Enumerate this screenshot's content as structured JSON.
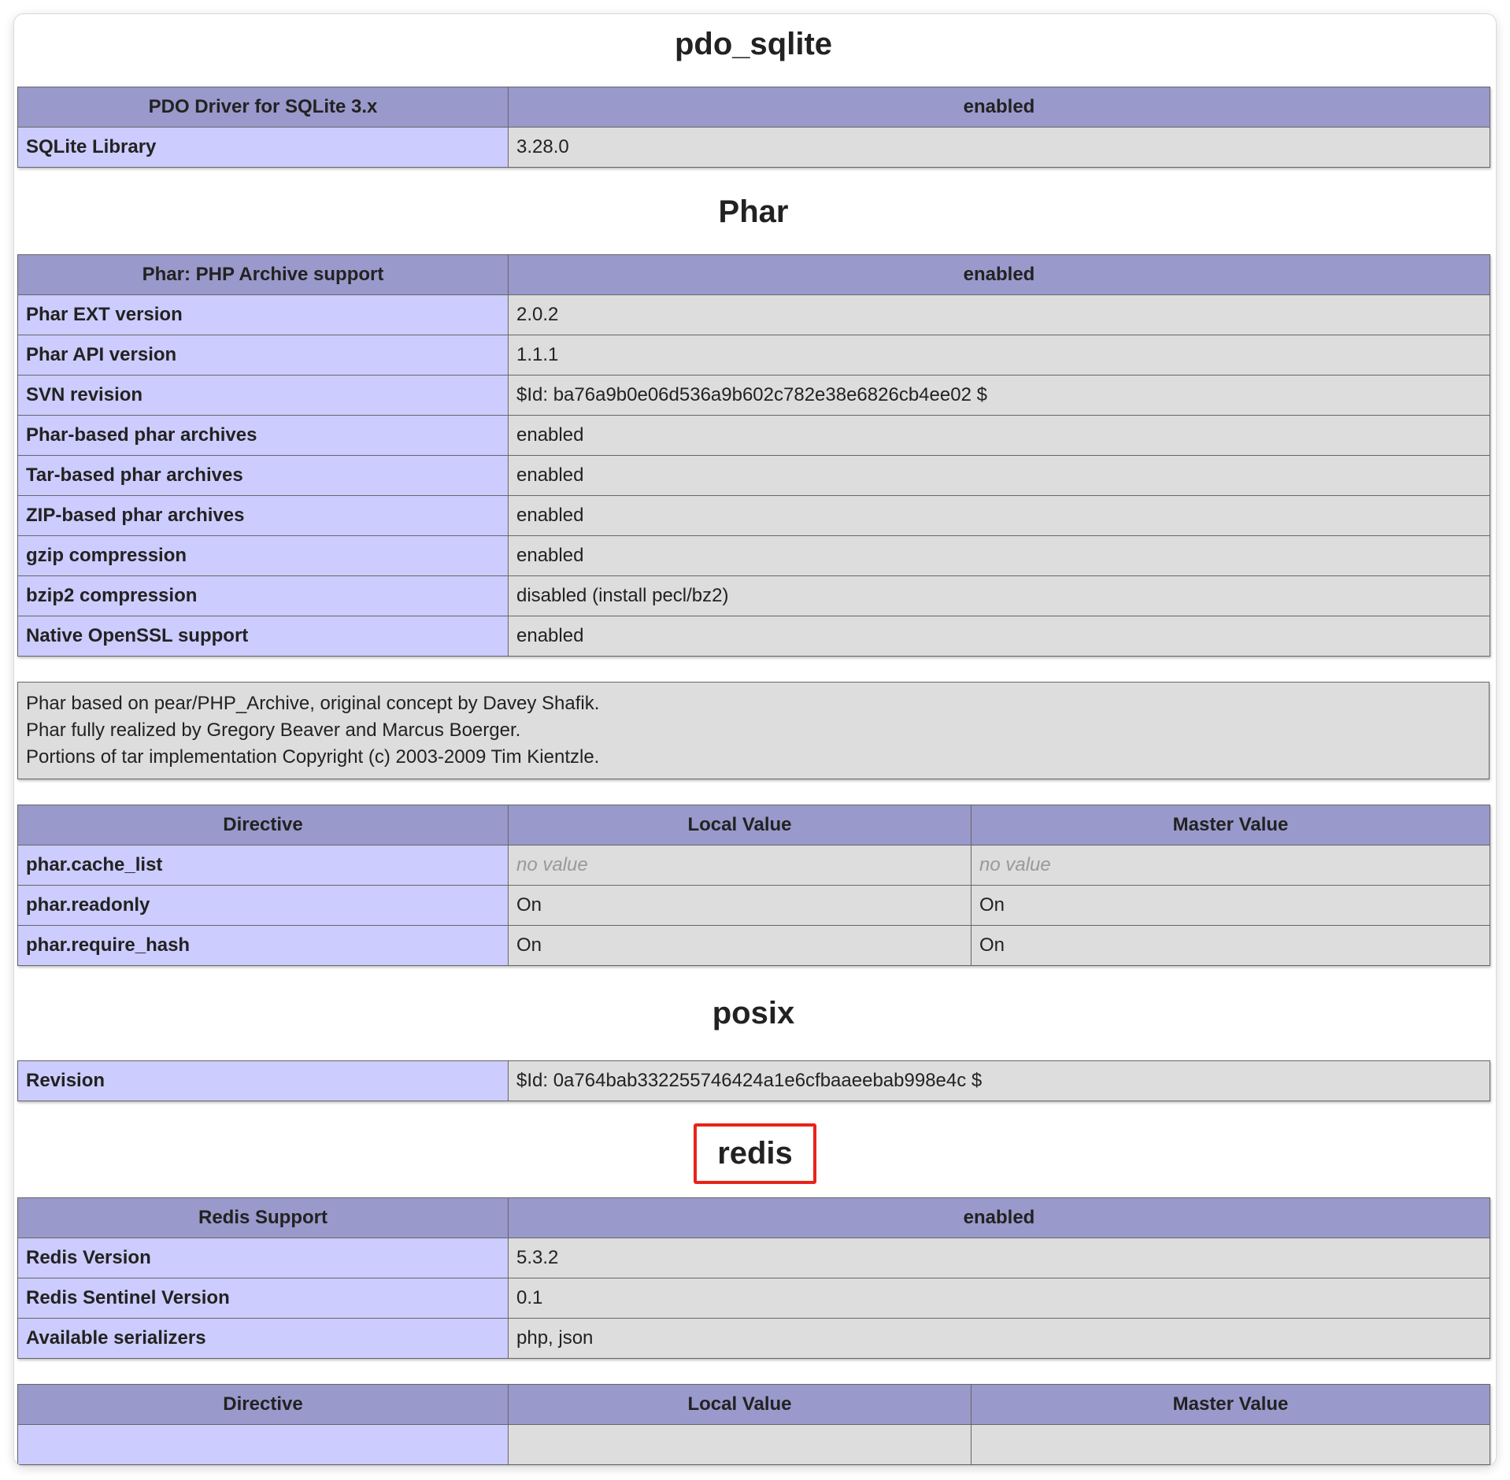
{
  "sections": {
    "pdo_sqlite": {
      "title": "pdo_sqlite",
      "header": [
        "PDO Driver for SQLite 3.x",
        "enabled"
      ],
      "rows": [
        [
          "SQLite Library",
          "3.28.0"
        ]
      ]
    },
    "phar": {
      "title": "Phar",
      "header": [
        "Phar: PHP Archive support",
        "enabled"
      ],
      "rows": [
        [
          "Phar EXT version",
          "2.0.2"
        ],
        [
          "Phar API version",
          "1.1.1"
        ],
        [
          "SVN revision",
          "$Id: ba76a9b0e06d536a9b602c782e38e6826cb4ee02 $"
        ],
        [
          "Phar-based phar archives",
          "enabled"
        ],
        [
          "Tar-based phar archives",
          "enabled"
        ],
        [
          "ZIP-based phar archives",
          "enabled"
        ],
        [
          "gzip compression",
          "enabled"
        ],
        [
          "bzip2 compression",
          "disabled (install pecl/bz2)"
        ],
        [
          "Native OpenSSL support",
          "enabled"
        ]
      ],
      "credits": [
        "Phar based on pear/PHP_Archive, original concept by Davey Shafik.",
        "Phar fully realized by Gregory Beaver and Marcus Boerger.",
        "Portions of tar implementation Copyright (c) 2003-2009 Tim Kientzle."
      ],
      "directives_header": [
        "Directive",
        "Local Value",
        "Master Value"
      ],
      "directives": [
        [
          "phar.cache_list",
          "no value",
          "no value"
        ],
        [
          "phar.readonly",
          "On",
          "On"
        ],
        [
          "phar.require_hash",
          "On",
          "On"
        ]
      ]
    },
    "posix": {
      "title": "posix",
      "rows": [
        [
          "Revision",
          "$Id: 0a764bab332255746424a1e6cfbaaeebab998e4c $"
        ]
      ]
    },
    "redis": {
      "title": "redis",
      "header": [
        "Redis Support",
        "enabled"
      ],
      "rows": [
        [
          "Redis Version",
          "5.3.2"
        ],
        [
          "Redis Sentinel Version",
          "0.1"
        ],
        [
          "Available serializers",
          "php, json"
        ]
      ],
      "directives_header": [
        "Directive",
        "Local Value",
        "Master Value"
      ]
    }
  },
  "colors": {
    "header_bg": "#9999cc",
    "key_bg": "#ccccff",
    "value_bg": "#dddddd",
    "highlight_border": "#e8231a"
  }
}
